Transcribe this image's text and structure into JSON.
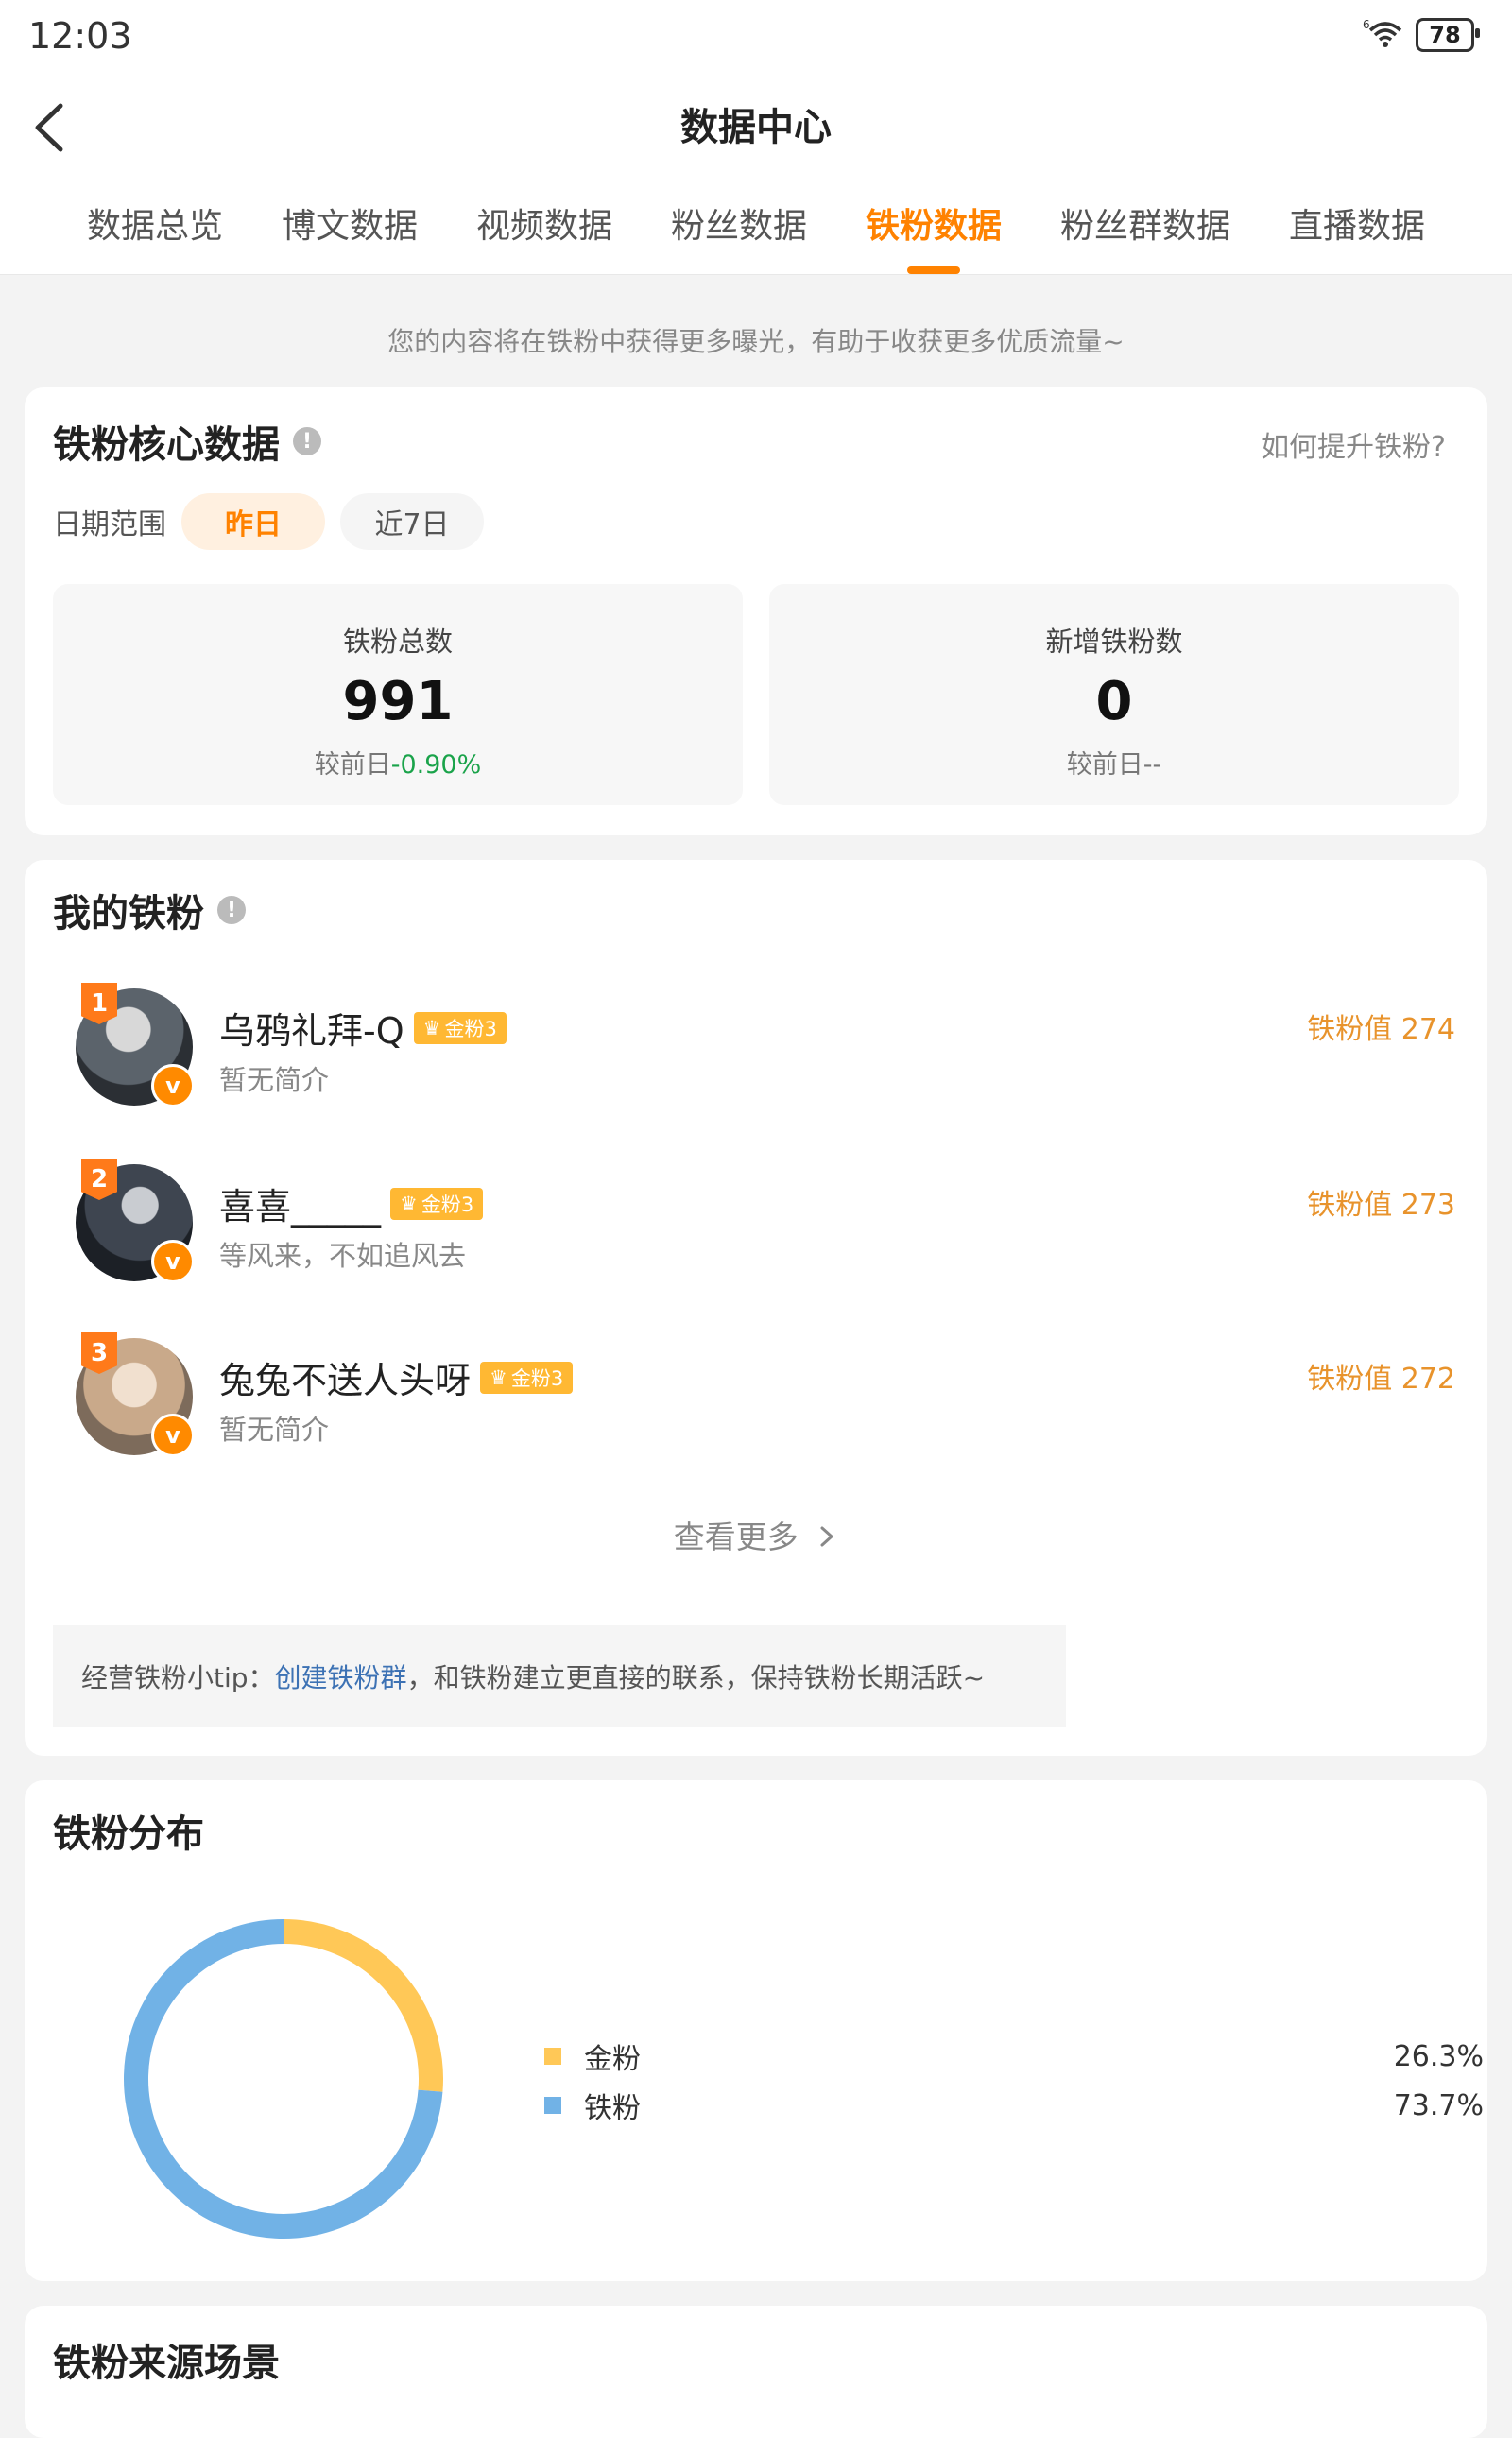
{
  "status_bar": {
    "time": "12:03",
    "battery": "78",
    "signal_label": "6"
  },
  "header": {
    "title": "数据中心"
  },
  "tabs": [
    "数据总览",
    "博文数据",
    "视频数据",
    "粉丝数据",
    "铁粉数据",
    "粉丝群数据",
    "直播数据"
  ],
  "active_tab": "铁粉数据",
  "notice": "您的内容将在铁粉中获得更多曝光，有助于收获更多优质流量~",
  "core": {
    "title": "铁粉核心数据",
    "help_link": "如何提升铁粉?",
    "range_label": "日期范围",
    "range_options": [
      "昨日",
      "近7日"
    ],
    "stats": [
      {
        "label": "铁粉总数",
        "value": "991",
        "compare_prefix": "较前日",
        "compare_value": "-0.90%"
      },
      {
        "label": "新增铁粉数",
        "value": "0",
        "compare_prefix": "较前日",
        "compare_value": "--"
      }
    ]
  },
  "my_fans": {
    "title": "我的铁粉",
    "fans": [
      {
        "rank": "1",
        "name": "乌鸦礼拜-Q",
        "badge": "金粉3",
        "bio": "暂无简介",
        "value_label": "铁粉值 274"
      },
      {
        "rank": "2",
        "name": "喜喜_____",
        "badge": "金粉3",
        "bio": "等风来，不如追风去",
        "value_label": "铁粉值 273"
      },
      {
        "rank": "3",
        "name": "兔兔不送人头呀",
        "badge": "金粉3",
        "bio": "暂无简介",
        "value_label": "铁粉值 272"
      }
    ],
    "see_more": "查看更多",
    "tip_prefix": "经营铁粉小tip：",
    "tip_link": "创建铁粉群",
    "tip_suffix": "，和铁粉建立更直接的联系，保持铁粉长期活跃~"
  },
  "distribution": {
    "title": "铁粉分布",
    "items": [
      {
        "label": "金粉",
        "percent": "26.3%",
        "color": "#ffc857"
      },
      {
        "label": "铁粉",
        "percent": "73.7%",
        "color": "#71b2e6"
      }
    ]
  },
  "chart_data": {
    "type": "pie",
    "categories": [
      "金粉",
      "铁粉"
    ],
    "values": [
      26.3,
      73.7
    ],
    "colors": [
      "#ffc857",
      "#71b2e6"
    ],
    "title": "铁粉分布",
    "donut": true
  },
  "source": {
    "title": "铁粉来源场景"
  }
}
